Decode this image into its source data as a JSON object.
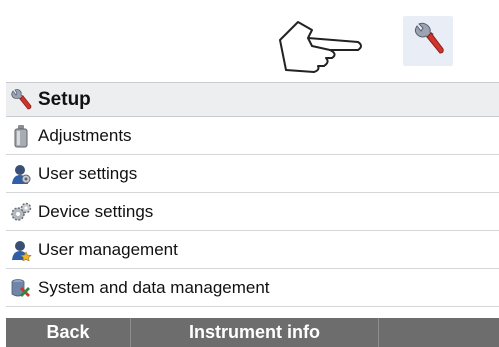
{
  "hint": {
    "hand_icon": "pointing-hand-icon",
    "shortcut_icon": "wrench-icon"
  },
  "panel": {
    "title": "Setup",
    "title_icon": "wrench-icon"
  },
  "menu": [
    {
      "label": "Adjustments",
      "icon": "weight-icon"
    },
    {
      "label": "User settings",
      "icon": "user-settings-icon"
    },
    {
      "label": "Device settings",
      "icon": "gears-icon"
    },
    {
      "label": "User management",
      "icon": "users-icon"
    },
    {
      "label": "System and data management",
      "icon": "system-data-icon"
    }
  ],
  "footer": {
    "back_label": "Back",
    "info_label": "Instrument info",
    "third_label": ""
  },
  "colors": {
    "accent_red": "#d0342c",
    "footer_bg": "#6d6d6d",
    "header_bg": "#eceeef"
  }
}
